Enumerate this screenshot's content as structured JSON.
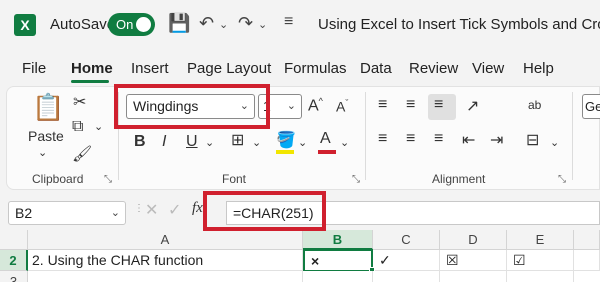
{
  "app": {
    "logo_letter": "X",
    "autosave_label": "AutoSave",
    "autosave_state": "On",
    "document_title": "Using Excel to Insert Tick Symbols and Cross Marks"
  },
  "tabs": [
    "File",
    "Home",
    "Insert",
    "Page Layout",
    "Formulas",
    "Data",
    "Review",
    "View",
    "Help"
  ],
  "active_tab": "Home",
  "ribbon": {
    "clipboard": {
      "paste_label": "Paste",
      "group_label": "Clipboard"
    },
    "font": {
      "font_name": "Wingdings",
      "font_size": "1",
      "bold": "B",
      "italic": "I",
      "underline": "U",
      "group_label": "Font"
    },
    "alignment": {
      "group_label": "Alignment",
      "wrap_label": "ab"
    },
    "number": {
      "format_partial": "Gen"
    }
  },
  "formula_bar": {
    "name_box": "B2",
    "fx": "fx",
    "formula": "=CHAR(251)"
  },
  "grid": {
    "columns": [
      "A",
      "B",
      "C",
      "D",
      "E"
    ],
    "rows": [
      "2",
      "3"
    ],
    "row2": {
      "A": "2. Using the CHAR function",
      "B": "×",
      "C": "✓",
      "D": "☒",
      "E": "☑"
    }
  },
  "colors": {
    "accent": "#107c41",
    "highlight": "#d0202e"
  }
}
